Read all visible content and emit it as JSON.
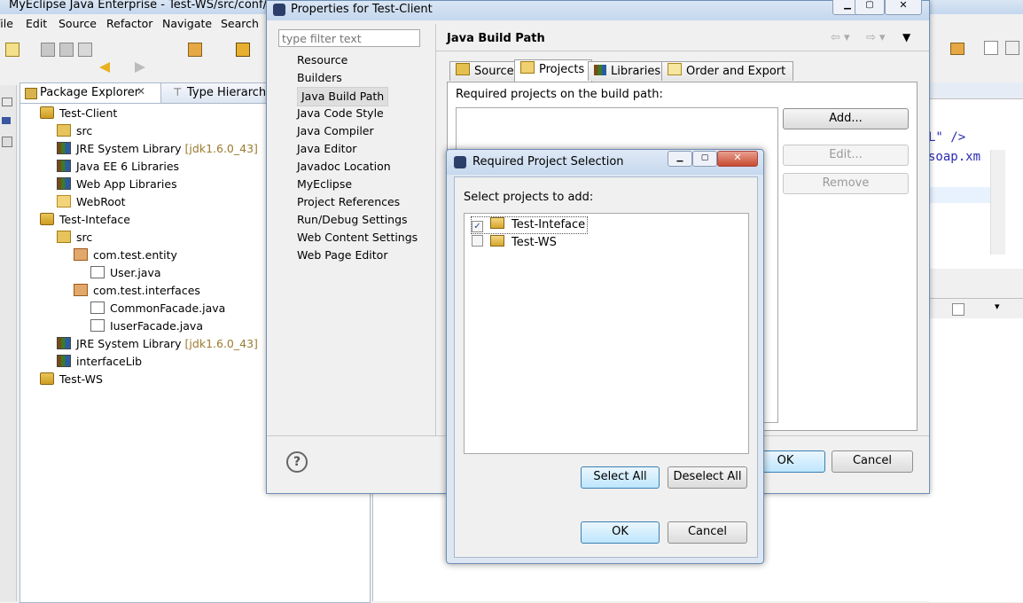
{
  "main_window": {
    "title": "MyEclipse Java Enterprise - Test-WS/src/conf/app",
    "menu": [
      "File",
      "Edit",
      "Source",
      "Refactor",
      "Navigate",
      "Search"
    ]
  },
  "explorer": {
    "tabs": [
      "Package Explorer",
      "Type Hierarchy"
    ],
    "tree": [
      {
        "label": "Test-Client",
        "icon": "project-icon",
        "indent": 0
      },
      {
        "label": "src",
        "icon": "source-folder-icon",
        "indent": 1
      },
      {
        "label": "JRE System Library",
        "suffix": "[jdk1.6.0_43]",
        "icon": "library-icon",
        "indent": 1
      },
      {
        "label": "Java EE 6 Libraries",
        "icon": "library-icon",
        "indent": 1
      },
      {
        "label": "Web App Libraries",
        "icon": "library-icon",
        "indent": 1
      },
      {
        "label": "WebRoot",
        "icon": "folder-icon",
        "indent": 1
      },
      {
        "label": "Test-Inteface",
        "icon": "project-icon",
        "indent": 0
      },
      {
        "label": "src",
        "icon": "source-folder-icon",
        "indent": 1
      },
      {
        "label": "com.test.entity",
        "icon": "package-icon",
        "indent": 2
      },
      {
        "label": "User.java",
        "icon": "java-file-icon",
        "indent": 3
      },
      {
        "label": "com.test.interfaces",
        "icon": "package-icon",
        "indent": 2
      },
      {
        "label": "CommonFacade.java",
        "icon": "java-file-icon",
        "indent": 3
      },
      {
        "label": "IuserFacade.java",
        "icon": "java-file-icon",
        "indent": 3
      },
      {
        "label": "JRE System Library",
        "suffix": "[jdk1.6.0_43]",
        "icon": "library-icon",
        "indent": 1
      },
      {
        "label": "interfaceLib",
        "icon": "library-icon",
        "indent": 1
      },
      {
        "label": "Test-WS",
        "icon": "project-icon",
        "indent": 0
      }
    ]
  },
  "editor_fragments": {
    "line1": "L\" />",
    "line2": "soap.xm"
  },
  "properties_dialog": {
    "title": "Properties for Test-Client",
    "filter_placeholder": "type filter text",
    "nav": [
      "Resource",
      "Builders",
      "Java Build Path",
      "Java Code Style",
      "Java Compiler",
      "Java Editor",
      "Javadoc Location",
      "MyEclipse",
      "Project References",
      "Run/Debug Settings",
      "Web Content Settings",
      "Web Page Editor"
    ],
    "selected_nav": "Java Build Path",
    "page_title": "Java Build Path",
    "tabs": [
      "Source",
      "Projects",
      "Libraries",
      "Order and Export"
    ],
    "active_tab": "Projects",
    "required_label": "Required projects on the build path:",
    "add": "Add...",
    "edit": "Edit...",
    "remove": "Remove",
    "ok": "OK",
    "cancel": "Cancel"
  },
  "selection_dialog": {
    "title": "Required Project Selection",
    "label": "Select projects to add:",
    "items": [
      {
        "label": "Test-Inteface",
        "checked": true
      },
      {
        "label": "Test-WS",
        "checked": false
      }
    ],
    "select_all": "Select All",
    "deselect_all": "Deselect All",
    "ok": "OK",
    "cancel": "Cancel"
  }
}
